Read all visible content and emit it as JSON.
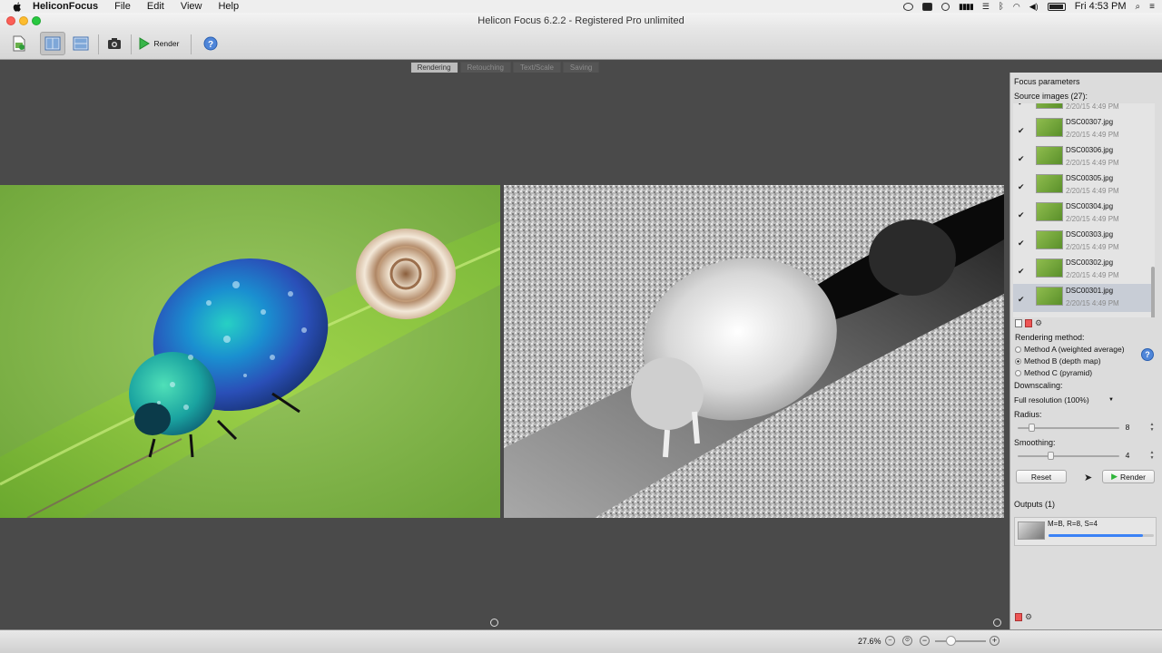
{
  "menubar": {
    "app_name": "HeliconFocus",
    "items": [
      "File",
      "Edit",
      "View",
      "Help"
    ],
    "clock": "Fri 4:53 PM"
  },
  "window": {
    "title": "Helicon Focus 6.2.2 - Registered Pro unlimited"
  },
  "toolbar": {
    "render_label": "Render"
  },
  "tabs": [
    "Rendering",
    "Retouching",
    "Text/Scale",
    "Saving"
  ],
  "panel": {
    "title": "Focus parameters",
    "source_images_label": "Source images (27):",
    "sources": [
      {
        "name": "",
        "date": "2/20/15 4:49 PM"
      },
      {
        "name": "DSC00307.jpg",
        "date": "2/20/15 4:49 PM"
      },
      {
        "name": "DSC00306.jpg",
        "date": "2/20/15 4:49 PM"
      },
      {
        "name": "DSC00305.jpg",
        "date": "2/20/15 4:49 PM"
      },
      {
        "name": "DSC00304.jpg",
        "date": "2/20/15 4:49 PM"
      },
      {
        "name": "DSC00303.jpg",
        "date": "2/20/15 4:49 PM"
      },
      {
        "name": "DSC00302.jpg",
        "date": "2/20/15 4:49 PM"
      },
      {
        "name": "DSC00301.jpg",
        "date": "2/20/15 4:49 PM"
      }
    ],
    "rendering_method_label": "Rendering method:",
    "methods": [
      "Method A (weighted average)",
      "Method B (depth map)",
      "Method C (pyramid)"
    ],
    "selected_method": 1,
    "downscaling_label": "Downscaling:",
    "downscaling_value": "Full resolution (100%)",
    "radius_label": "Radius:",
    "radius_value": "8",
    "smoothing_label": "Smoothing:",
    "smoothing_value": "4",
    "reset_label": "Reset",
    "render_label": "Render",
    "outputs_label": "Outputs (1)",
    "output_name": "M=B, R=8, S=4",
    "output_progress": 0.9
  },
  "status": {
    "zoom": "27.6%"
  },
  "colors": {
    "accent": "#3b82f6",
    "render_green": "#2fb53a"
  }
}
